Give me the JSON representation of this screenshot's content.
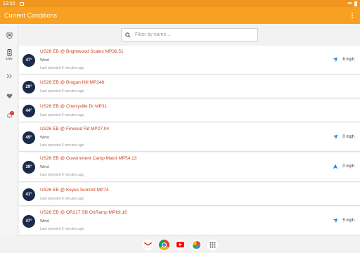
{
  "status_bar": {
    "time": "12:50"
  },
  "app_bar": {
    "title": "Current Conditions",
    "overflow_icon": "more-vert-icon"
  },
  "rail": {
    "items": [
      {
        "icon": "shield-icon",
        "label": ""
      },
      {
        "icon": "traffic-light-icon",
        "label": "Live"
      },
      {
        "icon": "road-icon",
        "label": ""
      },
      {
        "icon": "heart-icon",
        "label": ""
      },
      {
        "icon": "notifications-icon",
        "label": "",
        "badge": "7"
      }
    ]
  },
  "search": {
    "placeholder": "Filter by name..."
  },
  "colors": {
    "accent": "#f7a021",
    "name_text": "#c8421b",
    "temp_bg": "#1b2a4b",
    "arrow": "#1e88e5"
  },
  "stations": [
    {
      "temp": "47°",
      "name": "US26 EB @ Brightwood Scales MP36.51",
      "wind_label": "Wind",
      "reported": "Last reported 6 minutes ago",
      "speed": "6 mph",
      "arrow": "southwest"
    },
    {
      "temp": "29°",
      "name": "US26 EB @ Brogan Hill MP246",
      "wind_label": "",
      "reported": "Last reported 6 minutes ago",
      "speed": "",
      "arrow": ""
    },
    {
      "temp": "44°",
      "name": "US26 EB @ Cherryville Dr MP31",
      "wind_label": "",
      "reported": "Last reported 6 minutes ago",
      "speed": "",
      "arrow": ""
    },
    {
      "temp": "49°",
      "name": "US26 EB @ Firwood Rd MP27.04",
      "wind_label": "Wind",
      "reported": "Last reported 6 minutes ago",
      "speed": "0 mph",
      "arrow": "southwest"
    },
    {
      "temp": "39°",
      "name": "US26 EB @ Government Camp Maint MP54.13",
      "wind_label": "Wind",
      "reported": "Last reported 6 minutes ago",
      "speed": "0 mph",
      "arrow": "north"
    },
    {
      "temp": "41°",
      "name": "US26 EB @ Keyes Summit MP74",
      "wind_label": "",
      "reported": "Last reported 6 minutes ago",
      "speed": "",
      "arrow": ""
    },
    {
      "temp": "47°",
      "name": "US26 EB @ OR217 SB OnRamp MP69.16",
      "wind_label": "Wind",
      "reported": "Last reported 6 minutes ago",
      "speed": "5 mph",
      "arrow": "southwest"
    }
  ],
  "dock": {
    "apps": [
      "gmail-icon",
      "chrome-icon",
      "youtube-icon",
      "photos-icon",
      "app-drawer-icon"
    ]
  }
}
